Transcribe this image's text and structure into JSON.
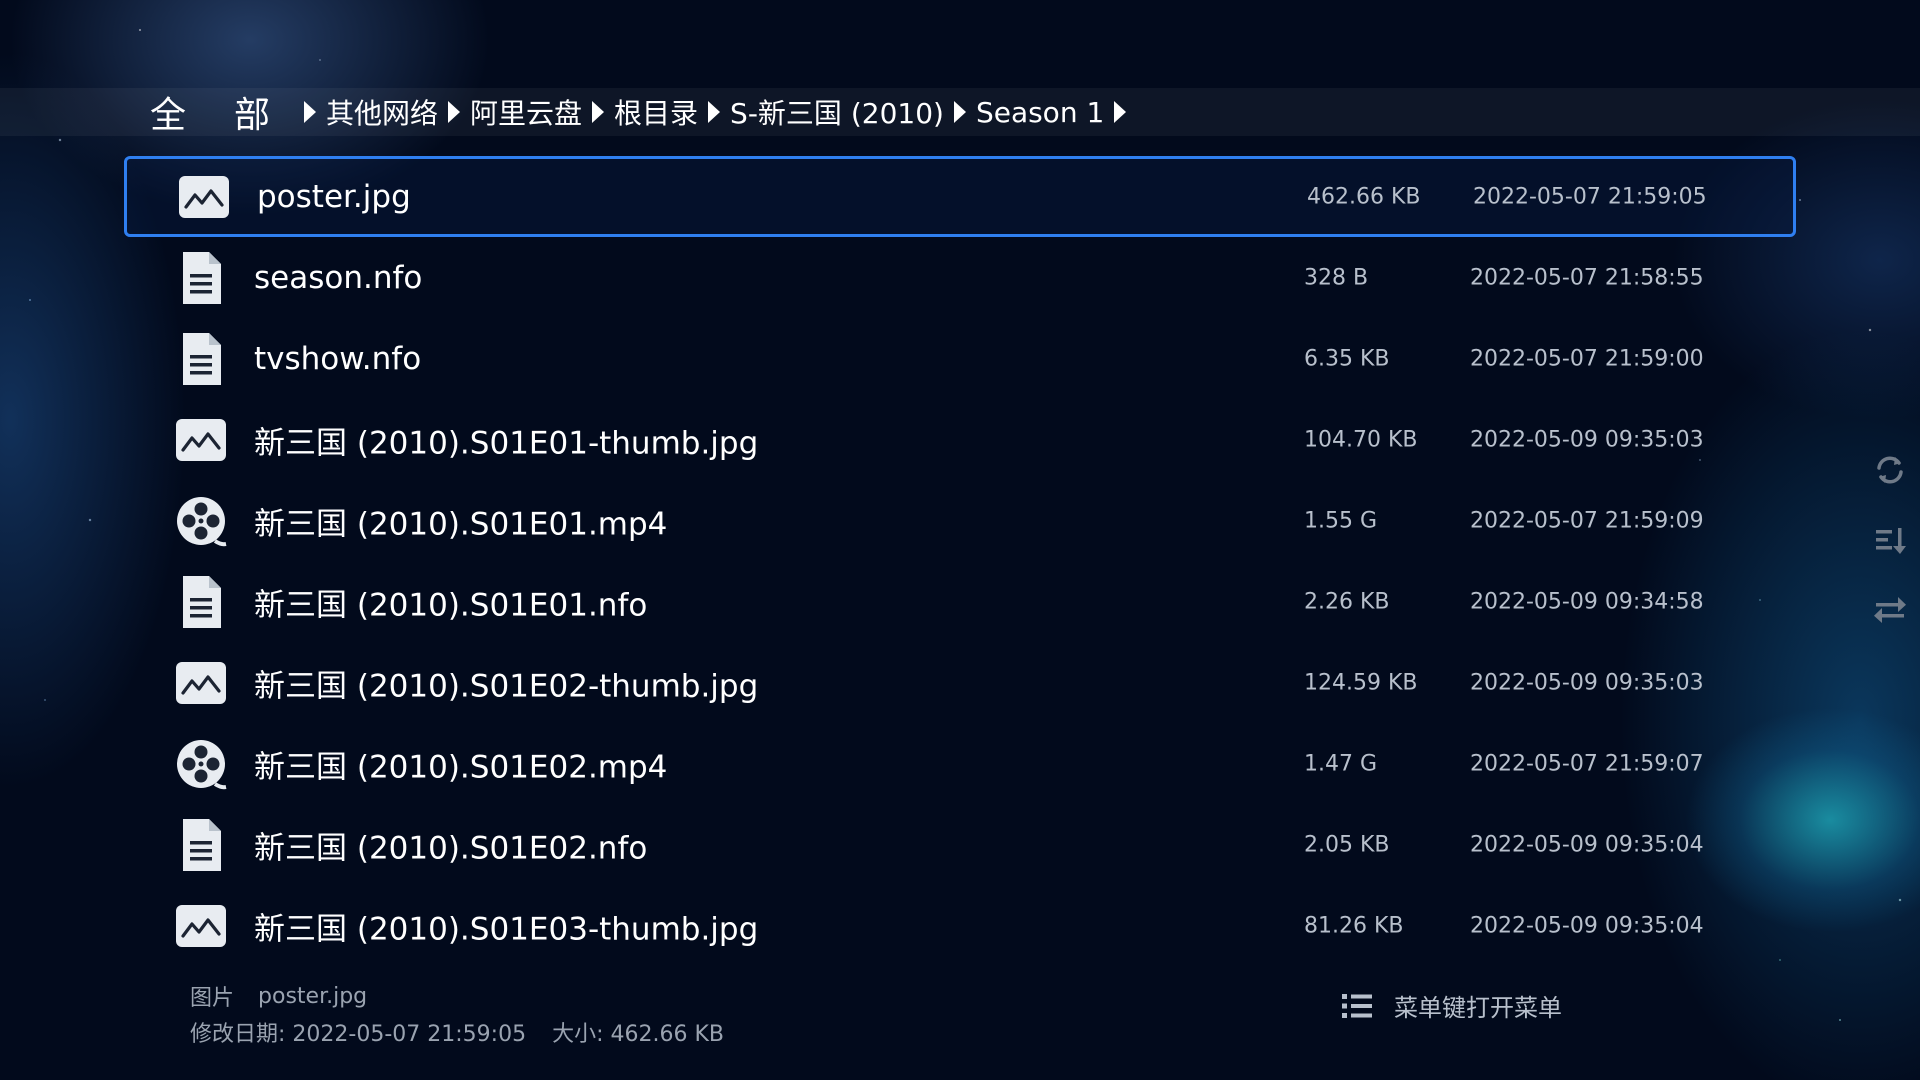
{
  "breadcrumb": {
    "root": [
      "全",
      "部"
    ],
    "items": [
      "其他网络",
      "阿里云盘",
      "根目录",
      "S-新三国 (2010)",
      "Season 1"
    ]
  },
  "files": [
    {
      "icon": "image-icon",
      "name": "poster.jpg",
      "size": "462.66 KB",
      "date": "2022-05-07 21:59:05",
      "selected": true
    },
    {
      "icon": "document-icon",
      "name": "season.nfo",
      "size": "328 B",
      "date": "2022-05-07 21:58:55"
    },
    {
      "icon": "document-icon",
      "name": "tvshow.nfo",
      "size": "6.35 KB",
      "date": "2022-05-07 21:59:00"
    },
    {
      "icon": "image-icon",
      "name": "新三国 (2010).S01E01-thumb.jpg",
      "size": "104.70 KB",
      "date": "2022-05-09 09:35:03"
    },
    {
      "icon": "film-reel-icon",
      "name": "新三国 (2010).S01E01.mp4",
      "size": "1.55 G",
      "date": "2022-05-07 21:59:09"
    },
    {
      "icon": "document-icon",
      "name": "新三国 (2010).S01E01.nfo",
      "size": "2.26 KB",
      "date": "2022-05-09 09:34:58"
    },
    {
      "icon": "image-icon",
      "name": "新三国 (2010).S01E02-thumb.jpg",
      "size": "124.59 KB",
      "date": "2022-05-09 09:35:03"
    },
    {
      "icon": "film-reel-icon",
      "name": "新三国 (2010).S01E02.mp4",
      "size": "1.47 G",
      "date": "2022-05-07 21:59:07"
    },
    {
      "icon": "document-icon",
      "name": "新三国 (2010).S01E02.nfo",
      "size": "2.05 KB",
      "date": "2022-05-09 09:35:04"
    },
    {
      "icon": "image-icon",
      "name": "新三国 (2010).S01E03-thumb.jpg",
      "size": "81.26 KB",
      "date": "2022-05-09 09:35:04"
    }
  ],
  "side_icons": [
    "refresh-icon",
    "sort-icon",
    "switch-icon"
  ],
  "footer": {
    "type_label": "图片",
    "file_name": "poster.jpg",
    "modified_label": "修改日期",
    "modified_value": ": 2022-05-07 21:59:05",
    "size_label": "大小",
    "size_value": ": 462.66 KB",
    "menu_icon": "list-icon",
    "menu_hint": "菜单键打开菜单"
  },
  "colors": {
    "background": "#020a1c",
    "selection_border": "#2f7ff0",
    "secondary_text": "#b8c0cc"
  }
}
